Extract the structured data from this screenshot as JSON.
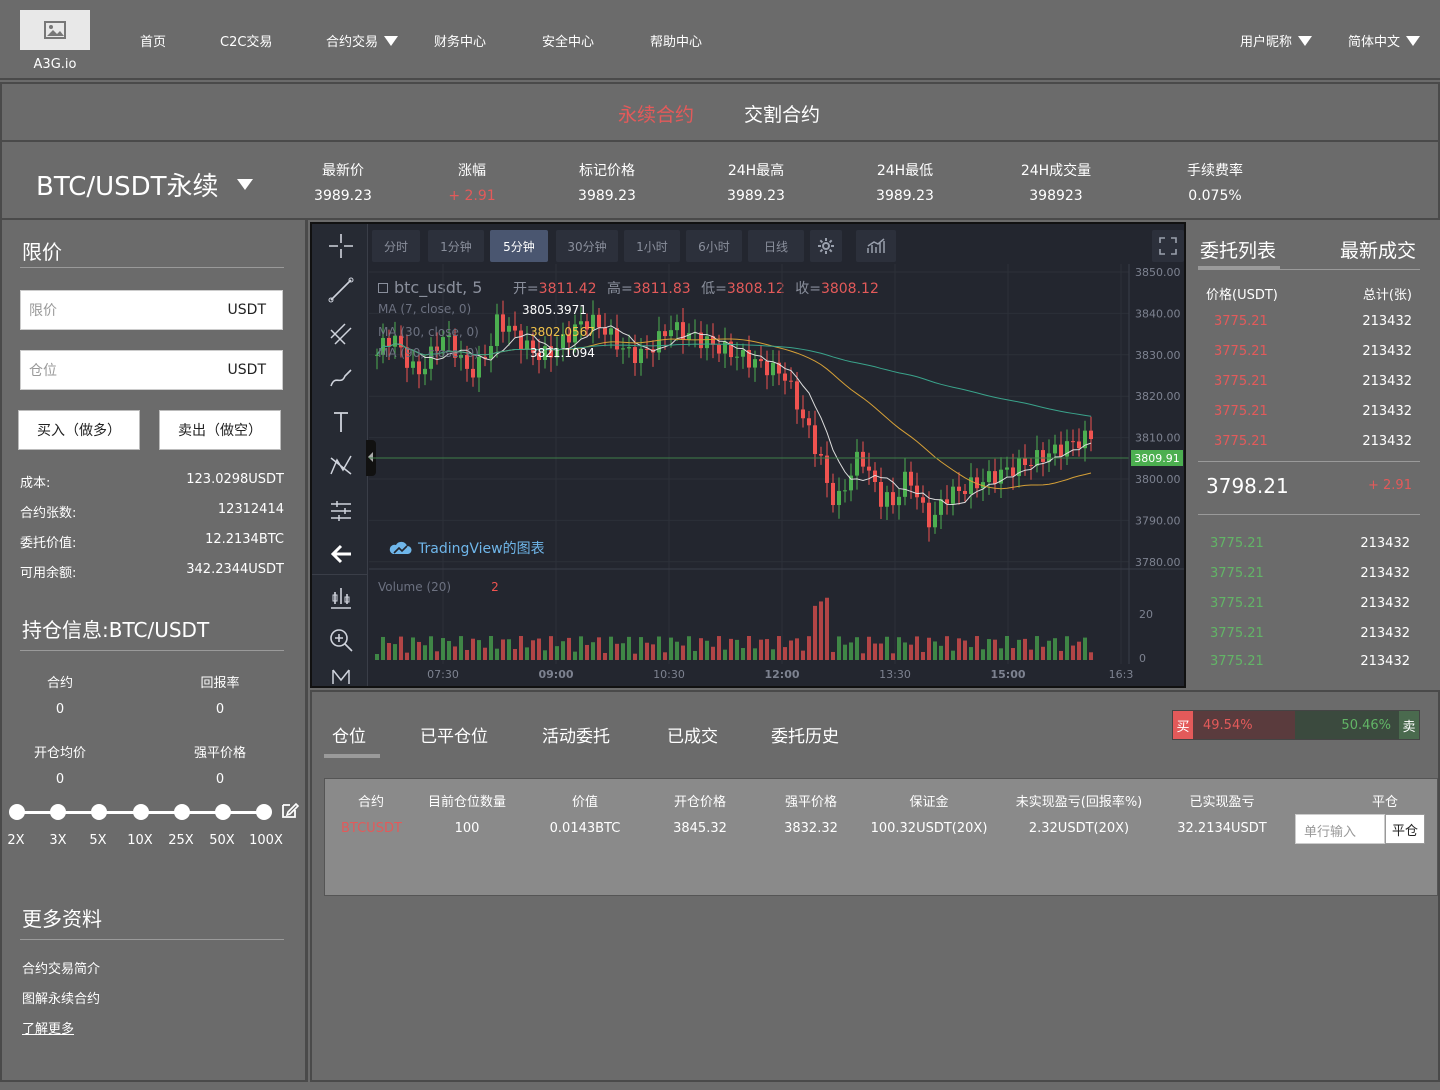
{
  "nav": {
    "logo_name": "A3G.io",
    "items": [
      "首页",
      "C2C交易",
      "合约交易",
      "财务中心",
      "安全中心",
      "帮助中心"
    ],
    "user": "用户昵称",
    "language": "简体中文"
  },
  "contract_tabs": [
    "永续合约",
    "交割合约"
  ],
  "ticker": {
    "pair": "BTC/USDT永续",
    "stats": [
      {
        "label": "最新价",
        "value": "3989.23"
      },
      {
        "label": "涨幅",
        "value": "+ 2.91"
      },
      {
        "label": "标记价格",
        "value": "3989.23"
      },
      {
        "label": "24H最高",
        "value": "3989.23"
      },
      {
        "label": "24H最低",
        "value": "3989.23"
      },
      {
        "label": "24H成交量",
        "value": "398923"
      },
      {
        "label": "手续费率",
        "value": "0.075%"
      }
    ]
  },
  "order_form": {
    "title": "限价",
    "price_placeholder": "限价",
    "price_unit": "USDT",
    "qty_placeholder": "仓位",
    "qty_unit": "USDT",
    "buy_label": "买入（做多）",
    "sell_label": "卖出（做空）",
    "info": [
      {
        "k": "成本:",
        "v": "123.0298USDT"
      },
      {
        "k": "合约张数:",
        "v": "12312414"
      },
      {
        "k": "委托价值:",
        "v": "12.2134BTC"
      },
      {
        "k": "可用余额:",
        "v": "342.2344USDT"
      }
    ]
  },
  "position_info": {
    "title": "持仓信息:BTC/USDT",
    "cells": [
      {
        "k": "合约",
        "v": "0"
      },
      {
        "k": "回报率",
        "v": "0"
      },
      {
        "k": "开仓均价",
        "v": "0"
      },
      {
        "k": "强平价格",
        "v": "0"
      }
    ],
    "leverage": [
      "2X",
      "3X",
      "5X",
      "10X",
      "25X",
      "50X",
      "100X"
    ]
  },
  "more_info": {
    "title": "更多资料",
    "links": [
      "合约交易简介",
      "图解永续合约",
      "了解更多"
    ]
  },
  "chart": {
    "intervals": [
      "分时",
      "1分钟",
      "5分钟",
      "30分钟",
      "1小时",
      "6小时",
      "日线"
    ],
    "active_interval": "5分钟",
    "symbol": "btc_usdt, 5",
    "ohlc": {
      "open_label": "开=",
      "open": "3811.42",
      "high_label": "高=",
      "high": "3811.83",
      "low_label": "低=",
      "low": "3808.12",
      "close_label": "收=",
      "close": "3808.12"
    },
    "ma_labels": [
      "MA (7, close, 0)",
      "MA (30, close, 0)",
      "MA (90, close, 0)"
    ],
    "ma_values": [
      "3805.3971",
      "3802.0567",
      "3821.1094"
    ],
    "watermark": "TradingView的图表",
    "price_ticks": [
      "3850.00",
      "3840.00",
      "3830.00",
      "3820.00",
      "3810.00",
      "3800.00",
      "3790.00",
      "3780.00"
    ],
    "current_price": "3809.91",
    "volume_label": "Volume (20)",
    "volume_value": "2",
    "volume_ticks": [
      "20",
      "0"
    ],
    "time_ticks": [
      "07:30",
      "09:00",
      "10:30",
      "12:00",
      "13:30",
      "15:00",
      "16:3"
    ],
    "colors": {
      "up": "#4caf50",
      "down": "#ef5350"
    }
  },
  "orderbook": {
    "tabs": [
      "委托列表",
      "最新成交"
    ],
    "col_price": "价格(USDT)",
    "col_total": "总计(张)",
    "asks": [
      {
        "p": "3775.21",
        "t": "213432"
      },
      {
        "p": "3775.21",
        "t": "213432"
      },
      {
        "p": "3775.21",
        "t": "213432"
      },
      {
        "p": "3775.21",
        "t": "213432"
      },
      {
        "p": "3775.21",
        "t": "213432"
      }
    ],
    "last_price": "3798.21",
    "last_change": "+ 2.91",
    "bids": [
      {
        "p": "3775.21",
        "t": "213432"
      },
      {
        "p": "3775.21",
        "t": "213432"
      },
      {
        "p": "3775.21",
        "t": "213432"
      },
      {
        "p": "3775.21",
        "t": "213432"
      },
      {
        "p": "3775.21",
        "t": "213432"
      }
    ]
  },
  "bottom": {
    "tabs": [
      "仓位",
      "已平仓位",
      "活动委托",
      "已成交",
      "委托历史"
    ],
    "ratio": {
      "buy_label": "买",
      "buy_pct": "49.54%",
      "sell_pct": "50.46%",
      "sell_label": "卖",
      "buy_fraction": 0.4954
    },
    "headers": [
      "合约",
      "目前仓位数量",
      "价值",
      "开仓价格",
      "强平价格",
      "保证金",
      "未实现盈亏(回报率%)",
      "已实现盈亏",
      "平仓"
    ],
    "row": [
      "BTCUSDT",
      "100",
      "0.0143BTC",
      "3845.32",
      "3832.32",
      "100.32USDT(20X)",
      "2.32USDT(20X)",
      "32.2134USDT"
    ],
    "close_placeholder": "单行输入",
    "close_button": "平仓"
  }
}
